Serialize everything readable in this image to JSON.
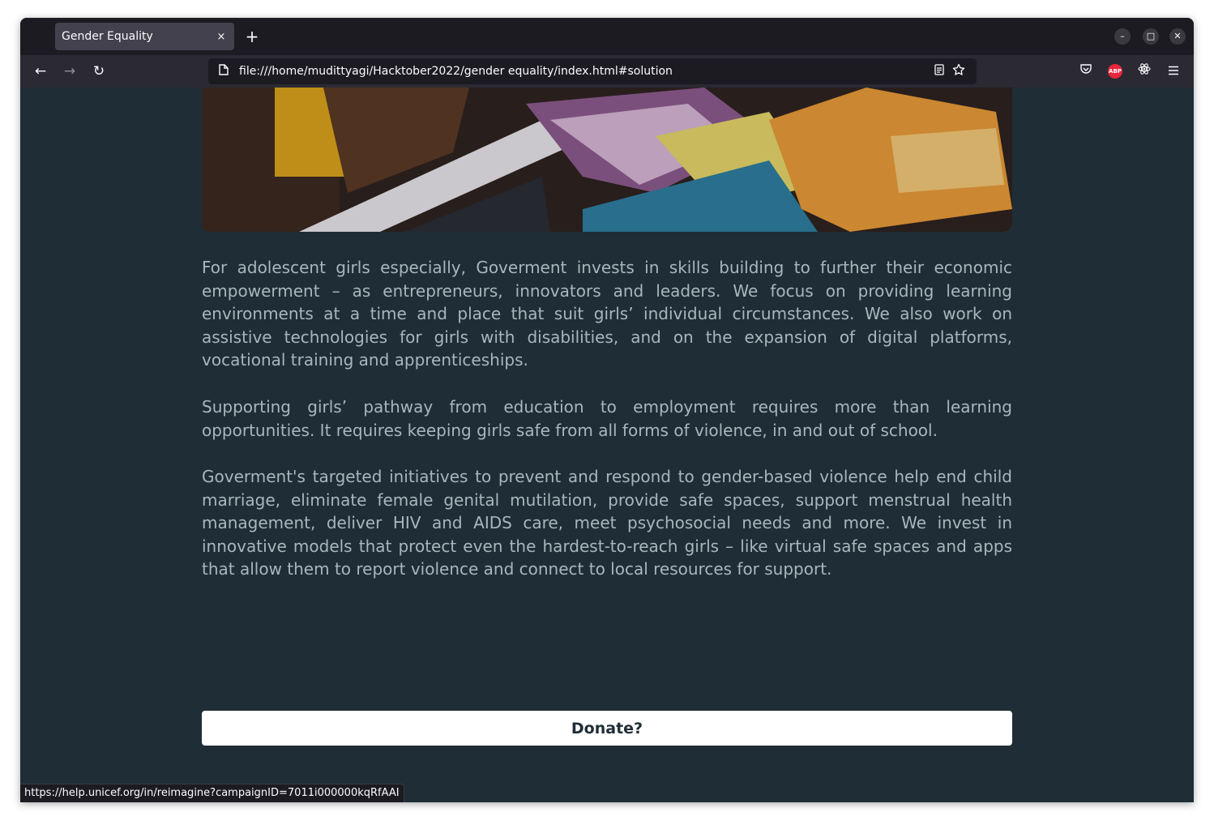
{
  "browser": {
    "tab_title": "Gender Equality",
    "tab_close": "×",
    "new_tab": "+",
    "url": "file:///home/mudittyagi/Hacktober2022/gender equality/index.html#solution",
    "status_url": "https://help.unicef.org/in/reimagine?campaignID=7011i000000kqRfAAI",
    "nav": {
      "back": "←",
      "forward": "→",
      "reload": "↻"
    },
    "window_controls": {
      "minimize": "–",
      "maximize": "□",
      "close": "✕"
    },
    "toolbar_icons": [
      "pocket-icon",
      "adblock-plus-icon",
      "react-devtools-icon",
      "menu-icon"
    ],
    "abp_label": "ABP"
  },
  "page": {
    "hero_image": "girls-studying-with-books-image",
    "paragraphs": [
      "For adolescent girls especially, Goverment invests in skills building to further their economic empowerment – as entrepreneurs, innovators and leaders. We focus on providing learning environments at a time and place that suit girls’ individual circumstances. We also work on assistive technologies for girls with disabilities, and on the expansion of digital platforms, vocational training and apprenticeships.",
      "Supporting girls’ pathway from education to employment requires more than learning opportunities. It requires keeping girls safe from all forms of violence, in and out of school.",
      "Goverment's targeted initiatives to prevent and respond to gender-based violence help end child marriage, eliminate female genital mutilation, provide safe spaces, support menstrual health management, deliver HIV and AIDS care, meet psychosocial needs and more. We invest in innovative models that protect even the hardest-to-reach girls – like virtual safe spaces and apps that allow them to report violence and connect to local resources for support."
    ],
    "donate_label": "Donate?"
  },
  "colors": {
    "page_background": "#1f2d36",
    "paragraph_text": "#a9b6bd",
    "donate_background": "#ffffff"
  }
}
